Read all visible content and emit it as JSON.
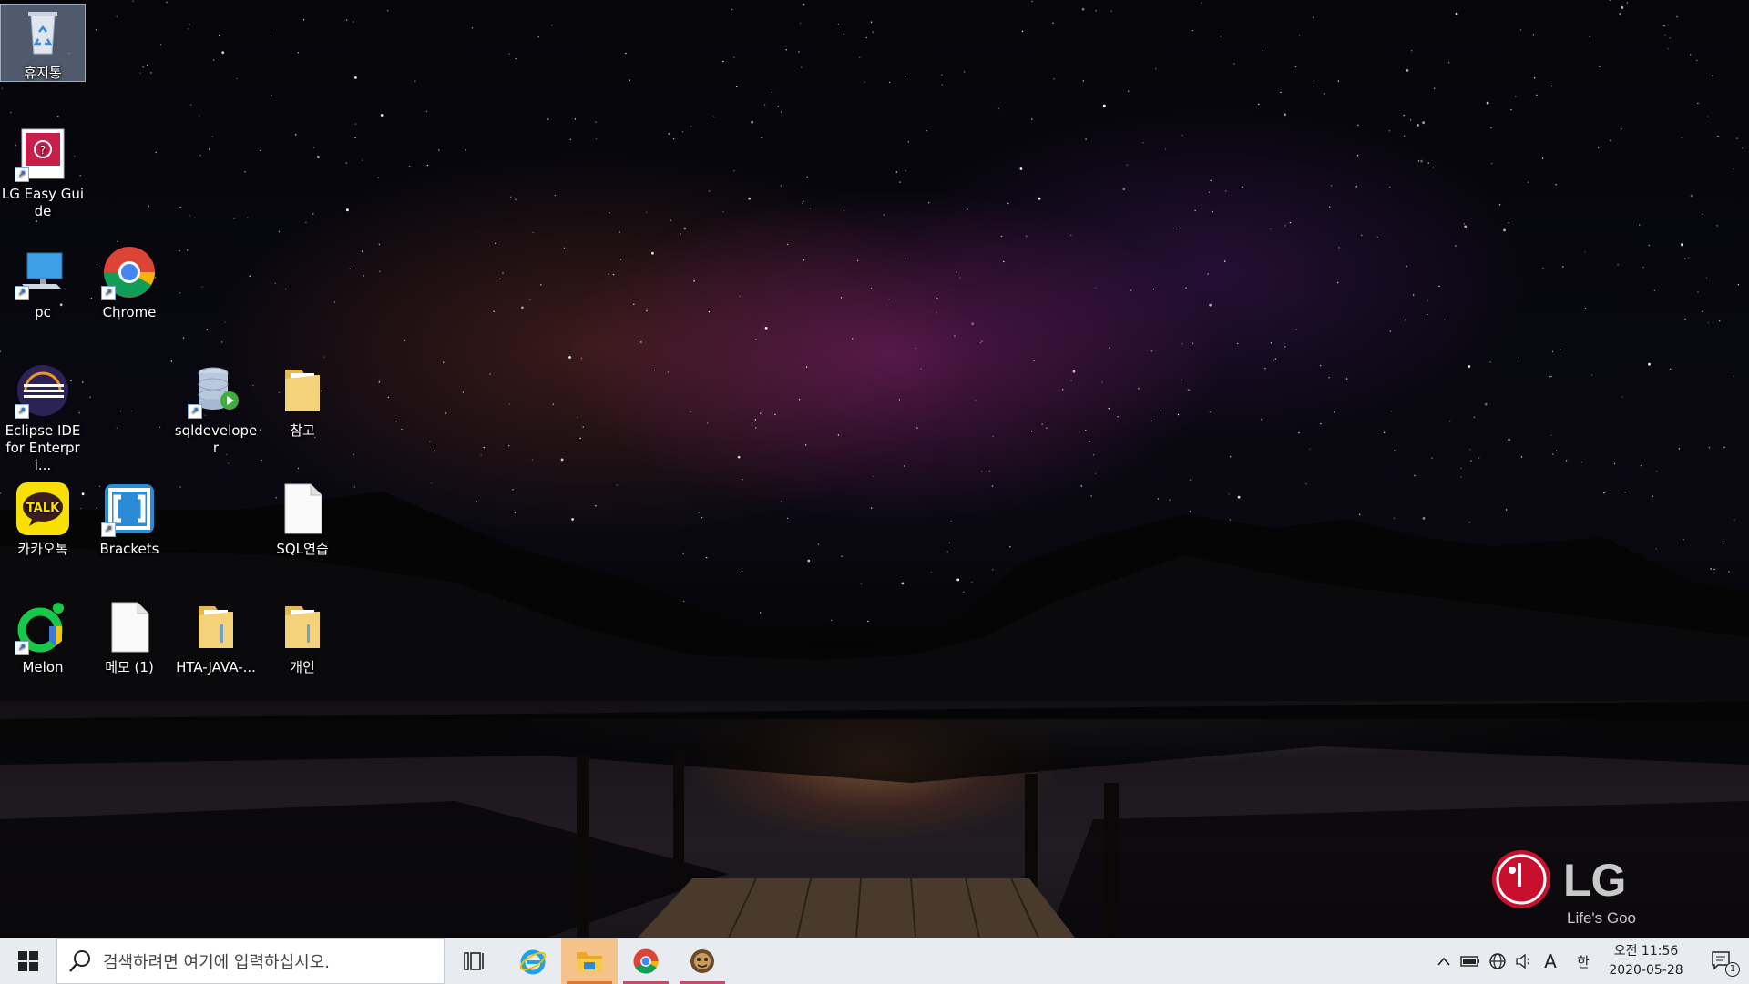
{
  "desktop": {
    "icons": [
      {
        "label": "휴지통",
        "icon": "recycle-bin-icon",
        "selected": true
      },
      {
        "label": "LG Easy Guide",
        "icon": "lg-easy-guide-icon"
      },
      {
        "label": "pc",
        "icon": "computer-icon"
      },
      {
        "label": "Chrome",
        "icon": "chrome-icon"
      },
      {
        "label": "Eclipse IDE for Enterpri...",
        "icon": "eclipse-icon"
      },
      {
        "label": "sqldeveloper",
        "icon": "sqldeveloper-icon"
      },
      {
        "label": "참고",
        "icon": "folder-icon"
      },
      {
        "label": "카카오톡",
        "icon": "kakaotalk-icon"
      },
      {
        "label": "Brackets",
        "icon": "brackets-icon"
      },
      {
        "label": "SQL연습",
        "icon": "text-file-icon"
      },
      {
        "label": "Melon",
        "icon": "melon-icon"
      },
      {
        "label": "메모 (1)",
        "icon": "text-file-icon"
      },
      {
        "label": "HTA-JAVA-...",
        "icon": "folder-icon"
      },
      {
        "label": "개인",
        "icon": "folder-icon"
      }
    ],
    "kakao_badge": "TALK",
    "wallpaper_logo": {
      "brand": "LG",
      "tagline": "Life's Good"
    }
  },
  "taskbar": {
    "search_placeholder": "검색하려면 여기에 입력하십시오.",
    "pinned": [
      "windows-start-icon",
      "task-view-icon",
      "internet-explorer-icon",
      "file-explorer-icon",
      "chrome-icon",
      "game-app-icon"
    ],
    "tray": {
      "ime_mode": "A",
      "ime_lang": "한",
      "time": "오전 11:56",
      "date": "2020-05-28",
      "notification_count": "1"
    }
  },
  "colors": {
    "taskbar_bg": "#e8ecf0",
    "active_indicator": "#c74b6a",
    "kakao_yellow": "#f9e000"
  }
}
